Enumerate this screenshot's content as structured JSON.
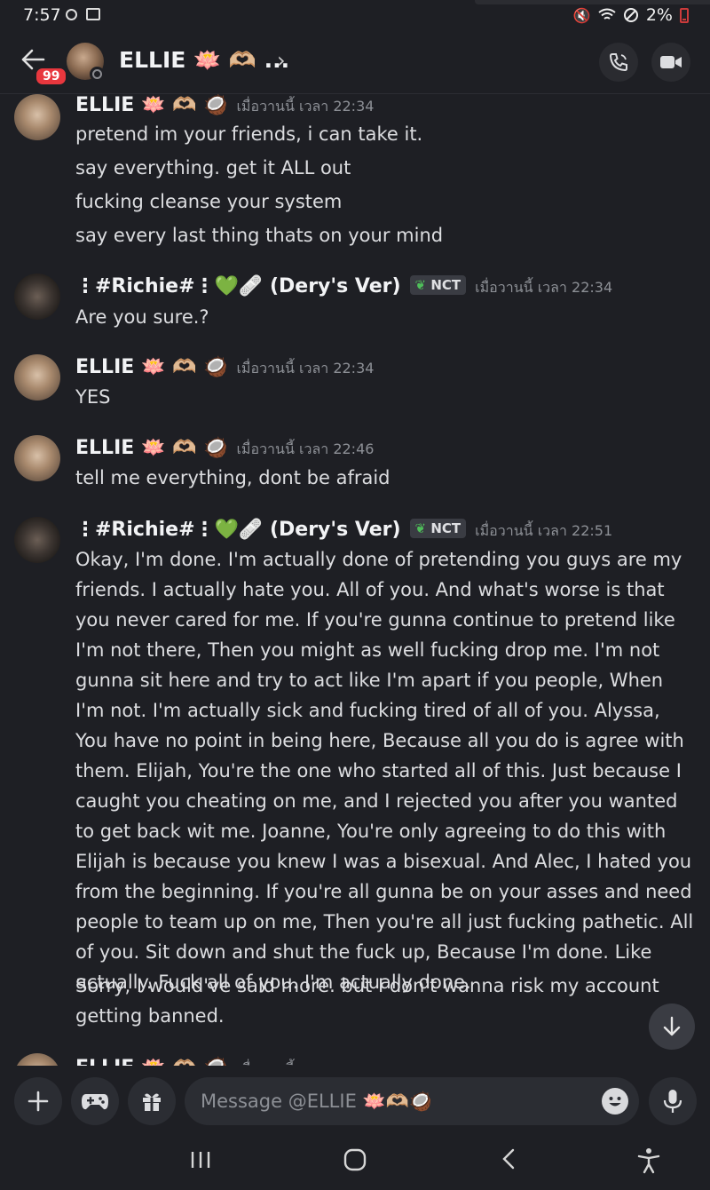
{
  "status_bar": {
    "time": "7:57",
    "battery": "2%"
  },
  "header": {
    "back_badge": "99",
    "name": "ELLIE 🪷 🫶🏼 ...",
    "chevron": "›"
  },
  "messages": [
    {
      "author": "ELLIE 🪷 🫶🏼 🥥",
      "timestamp": "เมื่อวานนี้ เวลา 22:34",
      "lines": [
        "pretend im your friends, i can take it.",
        "say everything. get it ALL out",
        "fucking cleanse your system",
        "say every last thing thats on your mind"
      ]
    },
    {
      "author": "⋮#Richie#⋮💚🩹 (Dery's Ver)",
      "tag": "NCT",
      "timestamp": "เมื่อวานนี้ เวลา 22:34",
      "lines": [
        "Are you sure.?"
      ]
    },
    {
      "author": "ELLIE 🪷 🫶🏼 🥥",
      "timestamp": "เมื่อวานนี้ เวลา 22:34",
      "lines": [
        "YES"
      ]
    },
    {
      "author": "ELLIE 🪷 🫶🏼 🥥",
      "timestamp": "เมื่อวานนี้ เวลา 22:46",
      "lines": [
        "tell me everything, dont be afraid"
      ]
    },
    {
      "author": "⋮#Richie#⋮💚🩹 (Dery's Ver)",
      "tag": "NCT",
      "timestamp": "เมื่อวานนี้ เวลา 22:51",
      "lines": [
        "Okay, I'm done. I'm actually done of pretending you guys are my friends. I actually hate you. All of you. And what's worse is that you never cared for me. If you're gunna continue to pretend like I'm not there, Then you might as well fucking drop me. I'm not gunna sit here and try to act like I'm apart if you people, When I'm not. I'm actually sick and fucking tired of all of you. Alyssa, You have no point in being here, Because all you do is agree with them. Elijah, You're the one who started all of this. Just because I caught you cheating on me, and I rejected you after you wanted to get back wit me. Joanne, You're only agreeing to do this with Elijah is because you knew I was  a bisexual. And Alec, I hated you from the beginning. If you're all gunna be on your asses and need people to team up on me, Then you're all just fucking pathetic. All of you. Sit down and shut the fuck up, Because I'm done. Like actually. Fuck all of you. I'm actually done.",
        "Sorry, I would've said more. but I don't wanna risk my account getting banned."
      ]
    },
    {
      "author": "ELLIE 🪷 🫶🏼 🥥",
      "timestamp": "เมื่อวานนี้"
    }
  ],
  "composer": {
    "placeholder": "Message @ELLIE 🪷🫶🏼🥥"
  },
  "icons": {
    "back": "back-arrow-icon",
    "call": "phone-icon",
    "video": "video-camera-icon",
    "add": "plus-icon",
    "games": "gamepad-icon",
    "gift": "gift-icon",
    "emoji": "emoji-icon",
    "mic": "microphone-icon",
    "scroll": "arrow-down-icon"
  },
  "colors": {
    "background": "#1e1f24",
    "badge": "#e8373e",
    "tag_leaf": "#4fbf5a"
  }
}
